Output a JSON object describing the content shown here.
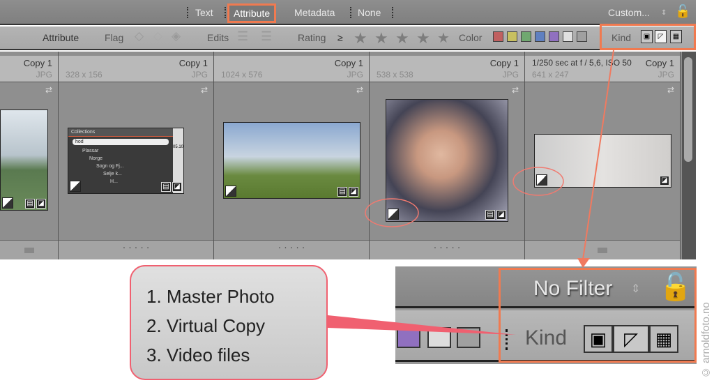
{
  "toolbar": {
    "tabs": [
      "Text",
      "Attribute",
      "Metadata",
      "None"
    ],
    "active_tab": "Attribute",
    "preset": "Custom...",
    "lock_icon": "lock-icon"
  },
  "filter": {
    "attribute": "Attribute",
    "flag": "Flag",
    "edits": "Edits",
    "rating": "Rating",
    "rating_op": "≥",
    "stars": [
      "★",
      "★",
      "★",
      "★",
      "★"
    ],
    "color": "Color",
    "kind": "Kind",
    "swatches": [
      "#c06060",
      "#c8c060",
      "#70a870",
      "#6080c0",
      "#9070c0",
      "#e0e0e0",
      "#a0a0a0"
    ],
    "kind_icons": [
      "master-photo-icon",
      "virtual-copy-icon",
      "video-icon"
    ]
  },
  "cells": [
    {
      "copy": "Copy 1",
      "type": "JPG",
      "dims": ""
    },
    {
      "copy": "Copy 1",
      "type": "JPG",
      "dims": "328 x 156"
    },
    {
      "copy": "Copy 1",
      "type": "JPG",
      "dims": "1024 x 576"
    },
    {
      "copy": "Copy 1",
      "type": "JPG",
      "dims": "538 x 538"
    },
    {
      "copy": "Copy 1",
      "type": "JPG",
      "dims": "641 x 247",
      "exif": "1/250 sec at f / 5,6, ISO 50"
    }
  ],
  "footer_dots": "· · · · ·",
  "collections_thumb": {
    "title": "Collections",
    "search": "hod",
    "items": [
      "Plassar",
      "Norge",
      "Sogn og Fj...",
      "Selje k...",
      "H..."
    ],
    "side": "05.10"
  },
  "callout": {
    "lines": [
      "1. Master Photo",
      "2. Virtual Copy",
      "3. Video files"
    ]
  },
  "inset": {
    "preset": "No Filter",
    "kind": "Kind"
  },
  "watermark": "© arnoldfoto.no",
  "accent": "#f07a50",
  "callout_border": "#f06070"
}
